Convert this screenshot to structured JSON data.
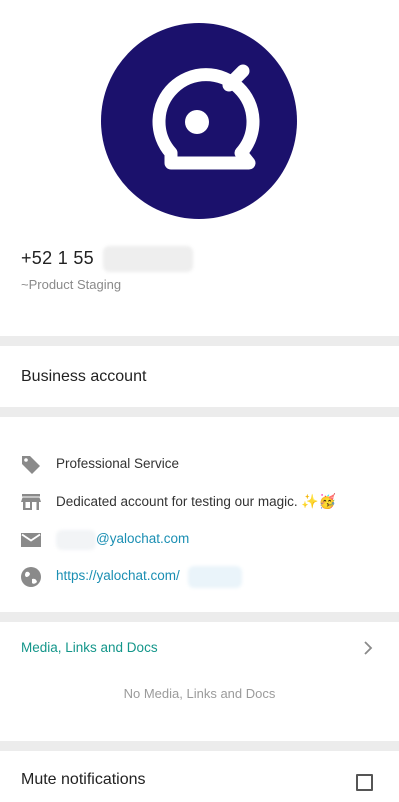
{
  "profile": {
    "phone_prefix": "+52 1 55",
    "subtitle": "~Product Staging",
    "avatar_color": "#1b116c",
    "avatar_icon": "yalo-logo-icon"
  },
  "business": {
    "label": "Business account"
  },
  "info": {
    "category": "Professional Service",
    "description": "Dedicated account for testing our magic.",
    "description_emoji": "✨🥳",
    "email_domain": "@yalochat.com",
    "website_prefix": "https://yalochat.com/"
  },
  "media": {
    "title": "Media, Links and Docs",
    "empty_text": "No Media, Links and Docs"
  },
  "settings": {
    "mute_label": "Mute notifications",
    "mute_checked": false
  },
  "colors": {
    "accent_teal": "#13968a",
    "link_blue": "#1b8fb3",
    "divider": "#ececec"
  }
}
